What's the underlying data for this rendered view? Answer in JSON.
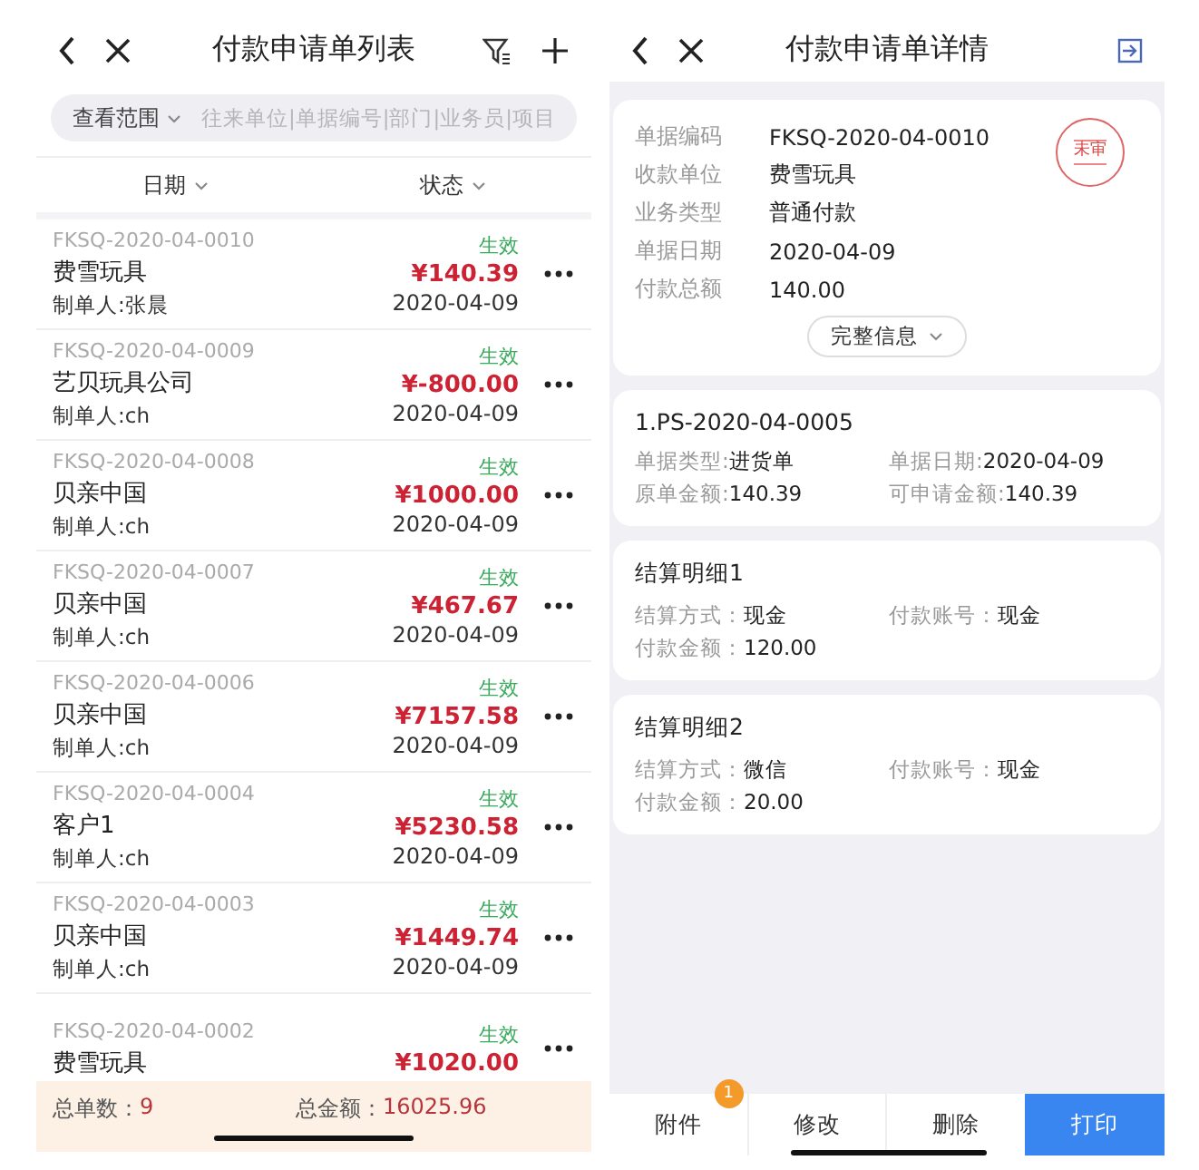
{
  "list_screen": {
    "title": "付款申请单列表",
    "search": {
      "scope": "查看范围",
      "placeholder": "往来单位|单据编号|部门|业务员|项目"
    },
    "columns": [
      {
        "label": "日期"
      },
      {
        "label": "状态"
      }
    ],
    "rows": [
      {
        "number": "FKSQ-2020-04-0010",
        "status": "生效",
        "name": "费雪玩具",
        "amount": "¥140.39",
        "creator": "制单人:张晨",
        "date": "2020-04-09"
      },
      {
        "number": "FKSQ-2020-04-0009",
        "status": "生效",
        "name": "艺贝玩具公司",
        "amount": "¥-800.00",
        "creator": "制单人:ch",
        "date": "2020-04-09"
      },
      {
        "number": "FKSQ-2020-04-0008",
        "status": "生效",
        "name": "贝亲中国",
        "amount": "¥1000.00",
        "creator": "制单人:ch",
        "date": "2020-04-09"
      },
      {
        "number": "FKSQ-2020-04-0007",
        "status": "生效",
        "name": "贝亲中国",
        "amount": "¥467.67",
        "creator": "制单人:ch",
        "date": "2020-04-09"
      },
      {
        "number": "FKSQ-2020-04-0006",
        "status": "生效",
        "name": "贝亲中国",
        "amount": "¥7157.58",
        "creator": "制单人:ch",
        "date": "2020-04-09"
      },
      {
        "number": "FKSQ-2020-04-0004",
        "status": "生效",
        "name": "客户1",
        "amount": "¥5230.58",
        "creator": "制单人:ch",
        "date": "2020-04-09"
      },
      {
        "number": "FKSQ-2020-04-0003",
        "status": "生效",
        "name": "贝亲中国",
        "amount": "¥1449.74",
        "creator": "制单人:ch",
        "date": "2020-04-09"
      },
      {
        "number": "FKSQ-2020-04-0002",
        "status": "生效",
        "name": "费雪玩具",
        "amount": "¥1020.00"
      }
    ],
    "footer": {
      "count_label": "总单数：",
      "count": "9",
      "total_label": "总金额：",
      "total": "16025.96"
    }
  },
  "detail_screen": {
    "title": "付款申请单详情",
    "stamp": "未审",
    "fields": [
      {
        "label": "单据编码",
        "value": "FKSQ-2020-04-0010"
      },
      {
        "label": "收款单位",
        "value": "费雪玩具"
      },
      {
        "label": "业务类型",
        "value": "普通付款"
      },
      {
        "label": "单据日期",
        "value": "2020-04-09"
      },
      {
        "label": "付款总额",
        "value": "140.00"
      }
    ],
    "more_button": "完整信息",
    "cards": [
      {
        "title": "1.PS-2020-04-0005",
        "fields": [
          {
            "label": "单据类型:",
            "value": "进货单"
          },
          {
            "label": "单据日期:",
            "value": "2020-04-09"
          },
          {
            "label": "原单金额:",
            "value": "140.39"
          },
          {
            "label": "可申请金额:",
            "value": "140.39"
          }
        ]
      },
      {
        "title": "结算明细1",
        "fields": [
          {
            "label": "结算方式：",
            "value": "现金"
          },
          {
            "label": "付款账号：",
            "value": "现金"
          },
          {
            "label": "付款金额：",
            "value": "120.00"
          }
        ]
      },
      {
        "title": "结算明细2",
        "fields": [
          {
            "label": "结算方式：",
            "value": "微信"
          },
          {
            "label": "付款账号：",
            "value": "现金"
          },
          {
            "label": "付款金额：",
            "value": "20.00"
          }
        ]
      }
    ],
    "actions": [
      {
        "label": "附件",
        "kind": "tab",
        "badge": "1"
      },
      {
        "label": "修改",
        "kind": "tab"
      },
      {
        "label": "删除",
        "kind": "tab"
      },
      {
        "label": "打印",
        "kind": "primary"
      }
    ]
  }
}
